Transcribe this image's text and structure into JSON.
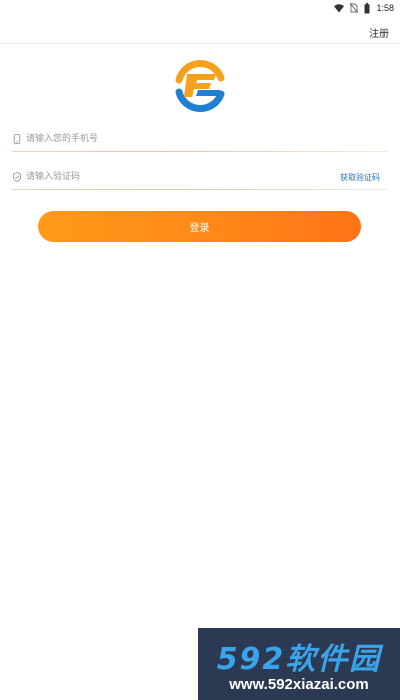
{
  "status_bar": {
    "time": "1:58",
    "icons": [
      "wifi-icon",
      "no-sim-icon",
      "battery-icon"
    ]
  },
  "header": {
    "register_label": "注册"
  },
  "logo": {
    "icon": "app-logo",
    "colors": {
      "orange": "#f5a11c",
      "blue": "#1f7fd0"
    }
  },
  "form": {
    "phone": {
      "placeholder": "请输入您的手机号",
      "value": "",
      "icon": "phone-icon"
    },
    "code": {
      "placeholder": "请输入验证码",
      "value": "",
      "icon": "shield-icon",
      "get_code_label": "获取验证码"
    },
    "login_label": "登录"
  },
  "watermark": {
    "brand": "592软件园",
    "url": "www.592xiazai.com"
  },
  "colors": {
    "accent": "#ff8a18",
    "link": "#2a6fba",
    "watermark_bg": "#2b3a52"
  }
}
